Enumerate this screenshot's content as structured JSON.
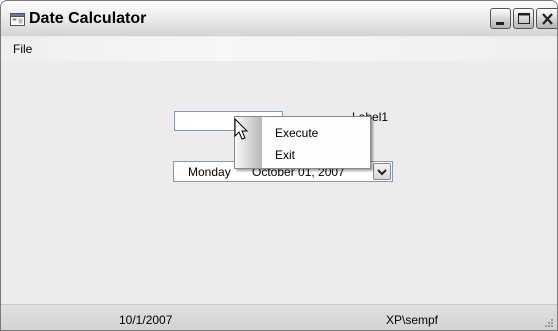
{
  "window": {
    "title": "Date Calculator"
  },
  "menu": {
    "file_label": "File"
  },
  "form": {
    "textbox_value": "",
    "label1": "Label1",
    "date_picker": {
      "day": "Monday",
      "date": "October 01, 2007"
    }
  },
  "context_menu": {
    "items": [
      {
        "label": "Execute"
      },
      {
        "label": "Exit"
      }
    ]
  },
  "status_bar": {
    "date": "10/1/2007",
    "user": "XP\\sempf"
  },
  "colors": {
    "window_bg": "#ececec",
    "field_border": "#7f9db9"
  }
}
